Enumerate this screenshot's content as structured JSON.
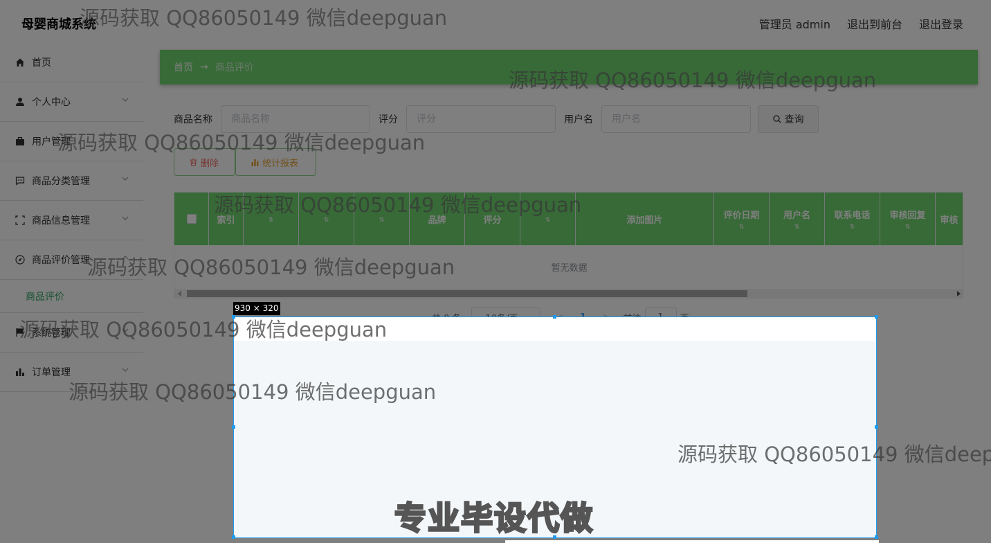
{
  "header": {
    "app_title": "母婴商城系统",
    "admin_label": "管理员 admin",
    "to_front_label": "退出到前台",
    "logout_label": "退出登录"
  },
  "sidebar": {
    "items": [
      {
        "label": "首页",
        "icon": "home-icon"
      },
      {
        "label": "个人中心",
        "icon": "user-icon"
      },
      {
        "label": "用户管理",
        "icon": "briefcase-icon"
      },
      {
        "label": "商品分类管理",
        "icon": "chat-icon"
      },
      {
        "label": "商品信息管理",
        "icon": "fullscreen-icon"
      },
      {
        "label": "商品评价管理",
        "icon": "compass-icon"
      },
      {
        "label": "系统管理",
        "icon": "flag-icon"
      },
      {
        "label": "订单管理",
        "icon": "chart-icon"
      }
    ],
    "sub_active": "商品评价"
  },
  "breadcrumb": {
    "home": "首页",
    "separator": "→",
    "current": "商品评价"
  },
  "search": {
    "fields": [
      {
        "label": "商品名称",
        "placeholder": "商品名称"
      },
      {
        "label": "评分",
        "placeholder": "评分"
      },
      {
        "label": "用户名",
        "placeholder": "用户名"
      }
    ],
    "query_label": "查询"
  },
  "actions": {
    "delete_label": "删除",
    "report_label": "统计报表"
  },
  "table": {
    "headers": [
      "",
      "索引",
      "",
      "",
      "",
      "品牌",
      "评分",
      "",
      "添加图片",
      "评价日期",
      "用户名",
      "联系电话",
      "审核回复",
      "审核"
    ],
    "empty_text": "暂无数据"
  },
  "pagination": {
    "total": "共 0 条",
    "page_size": "10条/页",
    "prev": "<",
    "page": "1",
    "next": ">",
    "goto": "前往",
    "goto_value": "1",
    "page_suffix": "页"
  },
  "overlay": {
    "dimensions": "930 × 320",
    "promo": "专业毕设代做"
  },
  "watermarks": [
    "源码获取 QQ86050149 微信deepguan",
    "源码获取 QQ86050149 微信deepguan",
    "源码获取 QQ86050149 微信deepguan",
    "源码获取 QQ86050149 微信deepguan",
    "源码获取 QQ86050149 微信deepguan",
    "源码获取 QQ86050149 微信deepguan",
    "源码获取 QQ86050149 微信deepguan",
    "源码获取 QQ86050149 微信deep"
  ],
  "colors": {
    "accent_green": "#6fd46f",
    "active_menu": "#2fa463",
    "selection_border": "#1e9bef"
  }
}
